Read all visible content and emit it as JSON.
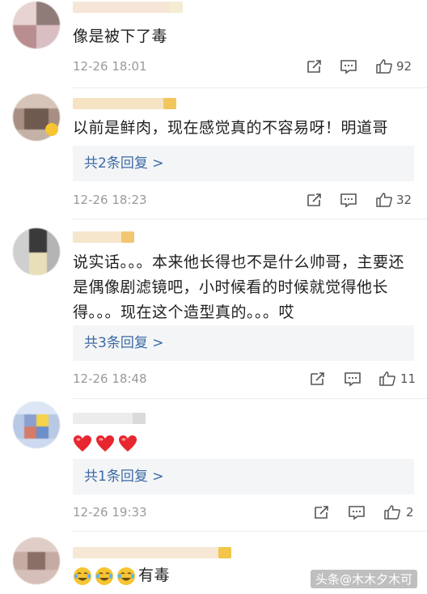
{
  "comments": [
    {
      "text": "像是被下了毒",
      "time": "12-26 18:01",
      "likes": "92",
      "replies": null
    },
    {
      "text": "以前是鲜肉，现在感觉真的不容易呀！明道哥",
      "time": "12-26 18:23",
      "likes": "32",
      "replies": "共2条回复 >"
    },
    {
      "text": "说实话。。。本来他长得也不是什么帅哥，主要还是偶像剧滤镜吧，小时候看的时候就觉得他长得。。。现在这个造型真的。。。哎",
      "time": "12-26 18:48",
      "likes": "11",
      "replies": "共3条回复 >"
    },
    {
      "text": "",
      "emoji": "heart-emoji ×3",
      "time": "12-26 19:33",
      "likes": "2",
      "replies": "共1条回复 >"
    },
    {
      "text": "有毒",
      "emoji": "cry-laugh-emoji ×3",
      "time": "",
      "likes": "",
      "replies": null
    }
  ],
  "watermark": "头条@木木夕木可",
  "colors": {
    "reply_link": "#3b6aa6",
    "reply_bg": "#f4f5f6",
    "timestamp": "#9a9a9a",
    "heart": "#e8262f",
    "emoji_face": "#f7c531"
  },
  "icons": [
    "share-icon",
    "comment-icon",
    "like-icon"
  ]
}
